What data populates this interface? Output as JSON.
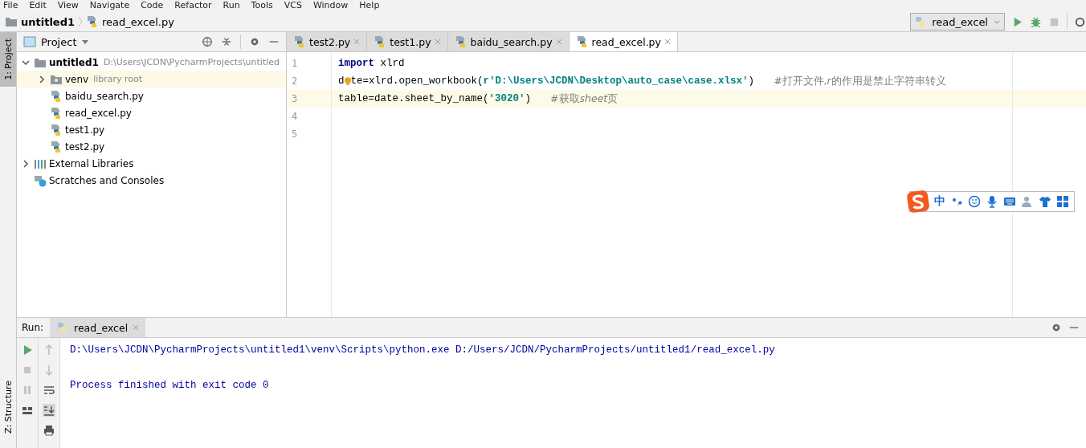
{
  "menu": [
    "File",
    "Edit",
    "View",
    "Navigate",
    "Code",
    "Refactor",
    "Run",
    "Tools",
    "VCS",
    "Window",
    "Help"
  ],
  "breadcrumb": [
    {
      "label": "untitled1",
      "kind": "folder"
    },
    {
      "label": "read_excel.py",
      "kind": "python"
    }
  ],
  "run_config": {
    "label": "read_excel"
  },
  "left_strip": [
    {
      "label": "1: Project",
      "selected": true
    },
    {
      "label": "Z: Structure",
      "selected": false
    }
  ],
  "project": {
    "title": "Project",
    "tree": [
      {
        "label": "untitled1",
        "hint": "D:\\Users\\JCDN\\PycharmProjects\\untitled",
        "kind": "folder",
        "expanded": true,
        "selected": false,
        "children": [
          {
            "label": "venv",
            "hint": "library root",
            "kind": "lib-folder",
            "expanded": false,
            "selected": true
          },
          {
            "label": "baidu_search.py",
            "kind": "python",
            "selected": false
          },
          {
            "label": "read_excel.py",
            "kind": "python",
            "selected": false
          },
          {
            "label": "test1.py",
            "kind": "python",
            "selected": false
          },
          {
            "label": "test2.py",
            "kind": "python",
            "selected": false
          }
        ]
      },
      {
        "label": "External Libraries",
        "kind": "libraries",
        "expanded": false,
        "selected": false
      },
      {
        "label": "Scratches and Consoles",
        "kind": "scratches",
        "selected": false
      }
    ]
  },
  "tabs": [
    {
      "label": "test2.py",
      "selected": false
    },
    {
      "label": "test1.py",
      "selected": false
    },
    {
      "label": "baidu_search.py",
      "selected": false
    },
    {
      "label": "read_excel.py",
      "selected": true
    }
  ],
  "editor": {
    "lines": [
      {
        "number": "1",
        "current": false,
        "tokens": [
          {
            "kind": "keyword",
            "text": "import"
          },
          {
            "kind": "plain",
            "text": " xlrd"
          }
        ]
      },
      {
        "number": "2",
        "current": false,
        "tokens": [
          {
            "kind": "plain",
            "text": "d"
          },
          {
            "kind": "bulb"
          },
          {
            "kind": "plain",
            "text": "te=xlrd.open_workbook("
          },
          {
            "kind": "string",
            "text": "r'D:\\Users\\JCDN\\Desktop\\auto_case\\case.xlsx'"
          },
          {
            "kind": "plain",
            "text": ")"
          },
          {
            "kind": "comment",
            "text": "#打开文件,"
          },
          {
            "kind": "comment-italic",
            "text": "r"
          },
          {
            "kind": "comment-rest",
            "text": "的作用是禁止字符串转义"
          }
        ]
      },
      {
        "number": "3",
        "current": true,
        "tokens": [
          {
            "kind": "plain",
            "text": "table=date.sheet_by_name("
          },
          {
            "kind": "string",
            "text": "'3020'"
          },
          {
            "kind": "plain",
            "text": ")"
          },
          {
            "kind": "comment",
            "text": "#获取"
          },
          {
            "kind": "comment-italic",
            "text": "sheet"
          },
          {
            "kind": "comment-rest",
            "text": "页"
          }
        ]
      },
      {
        "number": "4",
        "current": false
      },
      {
        "number": "5",
        "current": false
      }
    ]
  },
  "ime_toolbar": {
    "label": "中"
  },
  "run": {
    "title": "Run:",
    "tab": "read_excel",
    "output": [
      "D:\\Users\\JCDN\\PycharmProjects\\untitled1\\venv\\Scripts\\python.exe D:/Users/JCDN/PycharmProjects/untitled1/read_excel.py",
      "Process finished with exit code 0"
    ]
  }
}
